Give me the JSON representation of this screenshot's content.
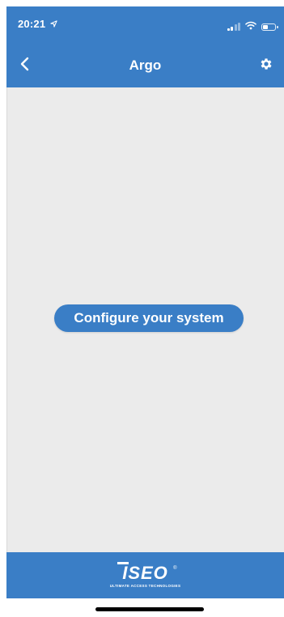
{
  "status_bar": {
    "time": "20:21",
    "location_icon": "location-arrow-icon",
    "signal_icon": "cellular-signal-icon",
    "wifi_icon": "wifi-icon",
    "battery_icon": "battery-icon"
  },
  "nav": {
    "title": "Argo",
    "back_icon": "chevron-left-icon",
    "settings_icon": "gear-icon"
  },
  "main": {
    "configure_button_label": "Configure your system"
  },
  "footer": {
    "brand": "ISEO",
    "tagline": "ULTIMATE ACCESS TECHNOLOGIES",
    "registered_mark": "®"
  },
  "colors": {
    "primary": "#3a7ec6",
    "content_background": "#ebebeb",
    "text_on_primary": "#ffffff"
  }
}
